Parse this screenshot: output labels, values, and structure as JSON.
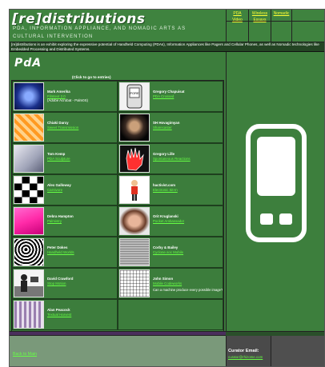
{
  "header": {
    "logo": "[re]distributions",
    "tagline_line1": "PDA, INFORMATION APPLIANCE, AND NOMADIC ARTS AS",
    "tagline_line2": "CULTURAL INTERVENTION",
    "nav": [
      {
        "label_line1": "PDA",
        "label_line2": "Video"
      },
      {
        "label_line1": "Wireless",
        "label_line2": "Essays"
      },
      {
        "label_line1": "Nomadic",
        "label_line2": ""
      }
    ]
  },
  "intro": "[re]distributions is an exhibit exploring the expressive potential of Handheld Computing (PDAs), Information Appliances like Pagers and Cellular Phones, as well as Nomadic technologies like Embedded Processing and Distributed Systems.",
  "main": {
    "title": "PdA",
    "click_note": "(Click to go to entries)",
    "entries": [
      {
        "artist": "Mark Amerika",
        "work": "Filmtext 2.0",
        "extra": "(Adobe Acrobat - Palm0S)",
        "thumb": "blue-screen"
      },
      {
        "artist": "Gregory Chapuisat",
        "work": "PDA Crossed",
        "extra": "",
        "thumb": "palm-device"
      },
      {
        "artist": "Chiaki Darcy",
        "work": "Sweet Transmission",
        "extra": "",
        "thumb": "orange-pattern"
      },
      {
        "artist": "SH Hovagimyan",
        "work": "Sharecaster",
        "extra": "",
        "thumb": "dark-portrait"
      },
      {
        "artist": "Tom Kemp",
        "work": "PDA Sculpture",
        "extra": "",
        "thumb": "metal-device"
      },
      {
        "artist": "Gregory Lille",
        "work": "Spontaneous Reactions",
        "extra": "",
        "thumb": "red-hand"
      },
      {
        "artist": "Alex Galloway",
        "work": "Carnivore",
        "extra": "",
        "thumb": "checker"
      },
      {
        "artist": "hactivist.com",
        "work": "Electronic Sit-In",
        "extra": "",
        "thumb": "figure"
      },
      {
        "artist": "Debra Hampton",
        "work": "Palmistry",
        "extra": "",
        "thumb": "pink-bird"
      },
      {
        "artist": "Orit Kruglanski",
        "work": "Pocket Ambassador",
        "extra": "",
        "thumb": "face"
      },
      {
        "artist": "Peter Dokes",
        "work": "Handheld Worlds",
        "extra": "",
        "thumb": "bw-texture"
      },
      {
        "artist": "Corby & Bailey",
        "work": "Cyclone.soc Mobile",
        "extra": "",
        "thumb": "gray-map"
      },
      {
        "artist": "David Crawford",
        "work": "Stop Motion",
        "extra": "",
        "thumb": "camera-man"
      },
      {
        "artist": "John Simon",
        "work": "Mobile Codeworks",
        "extra": "Can a machine produce every possible image?",
        "thumb": "grid"
      },
      {
        "artist": "Alan Peacock",
        "work": "Textual Harvest",
        "extra": "",
        "thumb": "stripes"
      }
    ]
  },
  "footer": {
    "back_link": "Back to Main",
    "curator_label": "Curator Email:",
    "curator_email": "curator@rhizome.com"
  },
  "colors": {
    "panel_green": "#3c7d3c",
    "link_green": "#66ff44",
    "nav_yellow": "#ffff33",
    "purple_bar": "#4a2f5c"
  }
}
